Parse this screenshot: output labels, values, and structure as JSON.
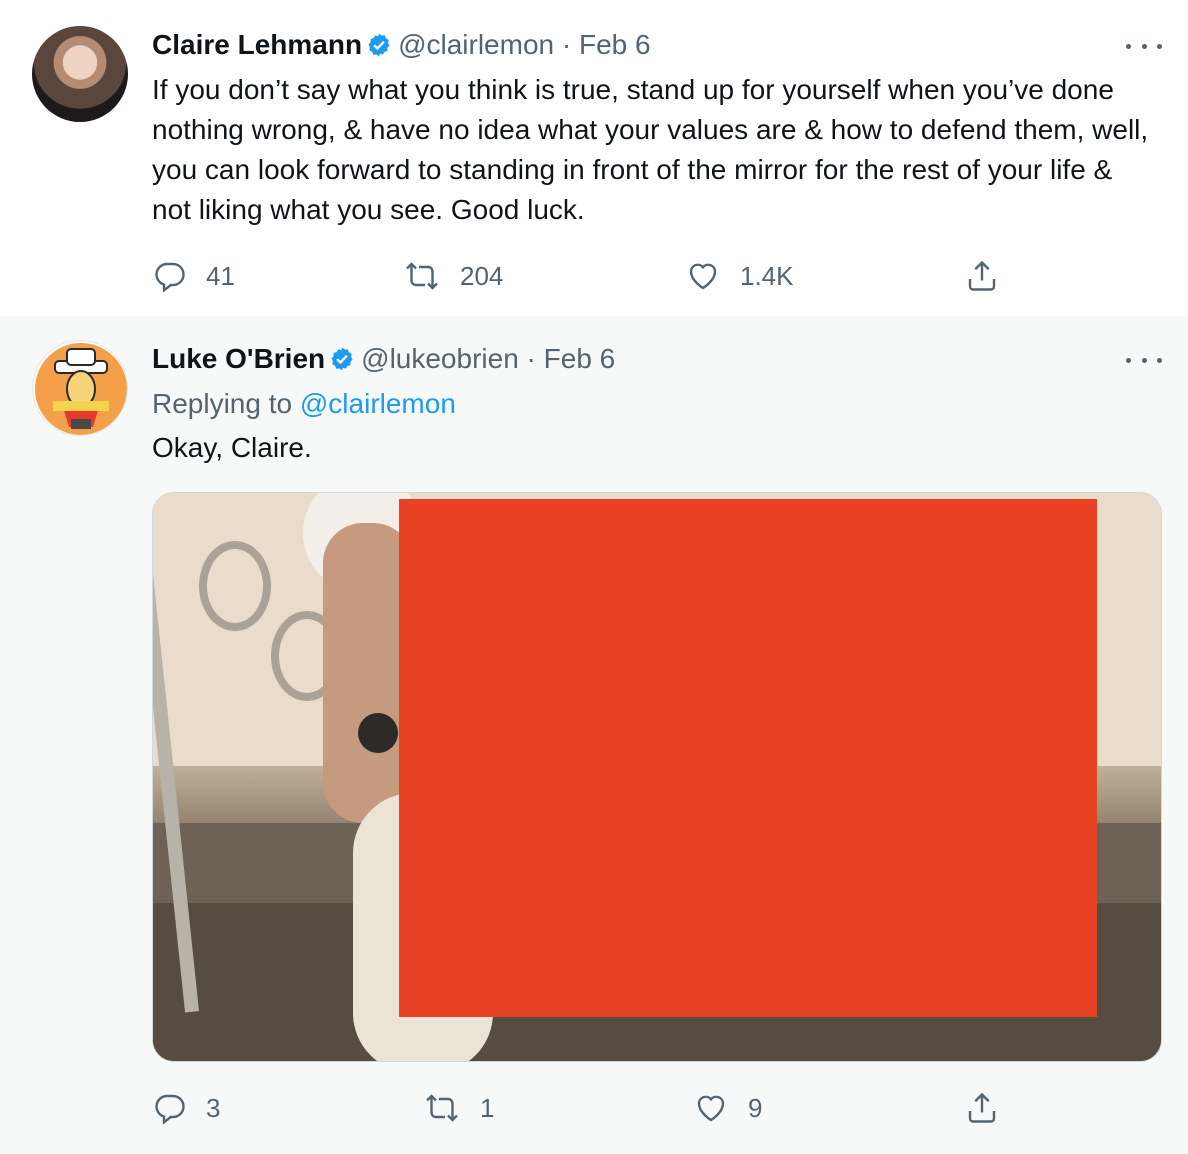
{
  "tweets": [
    {
      "name": "Claire Lehmann",
      "handle": "@clairlemon",
      "date": "· Feb 6",
      "text": "If you don’t say what you think is true, stand up for yourself when you’ve done nothing wrong, & have no idea what your values are & how to defend them, well, you can look forward to standing in front of the mirror for the rest of your life & not liking what you see. Good luck.",
      "counts": {
        "reply": "41",
        "retweet": "204",
        "like": "1.4K"
      }
    },
    {
      "name": "Luke O'Brien",
      "handle": "@lukeobrien",
      "date": "· Feb 6",
      "replying_prefix": "Replying to",
      "replying_handle": "@clairlemon",
      "text": "Okay, Claire.",
      "counts": {
        "reply": "3",
        "retweet": "1",
        "like": "9"
      }
    }
  ],
  "icons": {
    "verified": "verified-badge-icon",
    "more": "more-options-icon",
    "reply": "reply-icon",
    "retweet": "retweet-icon",
    "like": "like-icon",
    "share": "share-icon"
  },
  "colors": {
    "verified": "#1d9bf0",
    "muted": "#536471",
    "link": "#1d9bf0",
    "redaction": "#e84123"
  }
}
